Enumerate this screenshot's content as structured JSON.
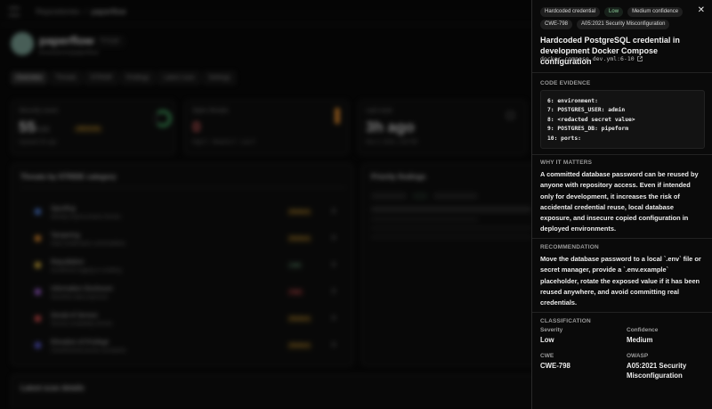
{
  "background": {
    "breadcrumb": {
      "root": "Repositories",
      "current": "paperflow"
    },
    "repo": {
      "name": "paperflow",
      "badge": "Private",
      "subtitle": "brockstrum/paperflow"
    },
    "tabs": [
      "Overview",
      "Threats",
      "STRIDE",
      "Findings",
      "Latest scan",
      "Settings"
    ],
    "cards": [
      {
        "label": "Security score",
        "value": "55",
        "unit": "/100",
        "pill": "MEDIUM",
        "foot": "Updated 3h ago"
      },
      {
        "label": "Open threats",
        "value": "0",
        "foot": "High 0 · Medium 0 · Low 0"
      },
      {
        "label": "Last scan",
        "value": "3h ago",
        "foot": "Nov 4, 2025, 1:54 PM"
      }
    ],
    "threats_title": "Threats by STRIDE category",
    "priority_title": "Priority findings",
    "threat_rows": [
      {
        "name": "Spoofing",
        "desc": "Identity impersonation threats",
        "level": "Medium",
        "count": "0"
      },
      {
        "name": "Tampering",
        "desc": "Data modification vulnerabilities",
        "level": "Medium",
        "count": "0"
      },
      {
        "name": "Repudiation",
        "desc": "Insufficient logging or auditing",
        "level": "Low",
        "count": "0"
      },
      {
        "name": "Information Disclosure",
        "desc": "Sensitive data exposure",
        "level": "High",
        "count": "0"
      },
      {
        "name": "Denial of Service",
        "desc": "Service availability threats",
        "level": "Medium",
        "count": "0"
      },
      {
        "name": "Elevation of Privilege",
        "desc": "Unauthorized access escalation",
        "level": "Medium",
        "count": "0"
      }
    ],
    "latest_title": "Latest scan details"
  },
  "panel": {
    "chips_row1": [
      "Hardcoded credential",
      "Low",
      "Medium confidence"
    ],
    "chips_row2": [
      "CWE-798",
      "A05:2021 Security Misconfiguration"
    ],
    "title": "Hardcoded PostgreSQL credential in development Docker Compose configuration",
    "file": "docker-compose.dev.yml:6-10",
    "code_heading": "CODE EVIDENCE",
    "code_lines": [
      "6: environment:",
      "7: POSTGRES_USER: admin",
      "8: <redacted secret value>",
      "9: POSTGRES_DB: pipeform",
      "10: ports:"
    ],
    "why_heading": "WHY IT MATTERS",
    "why_text": "A committed database password can be reused by anyone with repository access. Even if intended only for development, it increases the risk of accidental credential reuse, local database exposure, and insecure copied configuration in deployed environments.",
    "rec_heading": "RECOMMENDATION",
    "rec_text": "Move the database password to a local `.env` file or secret manager, provide a `.env.example` placeholder, rotate the exposed value if it has been reused anywhere, and avoid committing real credentials.",
    "class_heading": "CLASSIFICATION",
    "classification": {
      "severity_label": "Severity",
      "severity": "Low",
      "confidence_label": "Confidence",
      "confidence": "Medium",
      "cwe_label": "CWE",
      "cwe": "CWE-798",
      "owasp_label": "OWASP",
      "owasp": "A05:2021 Security Misconfiguration"
    },
    "close_icon": "close-icon"
  },
  "colors": {
    "low": "#8fd19e",
    "medium": "#d6a13a",
    "high": "#e06060",
    "accent_orange": "#e08a2a"
  }
}
